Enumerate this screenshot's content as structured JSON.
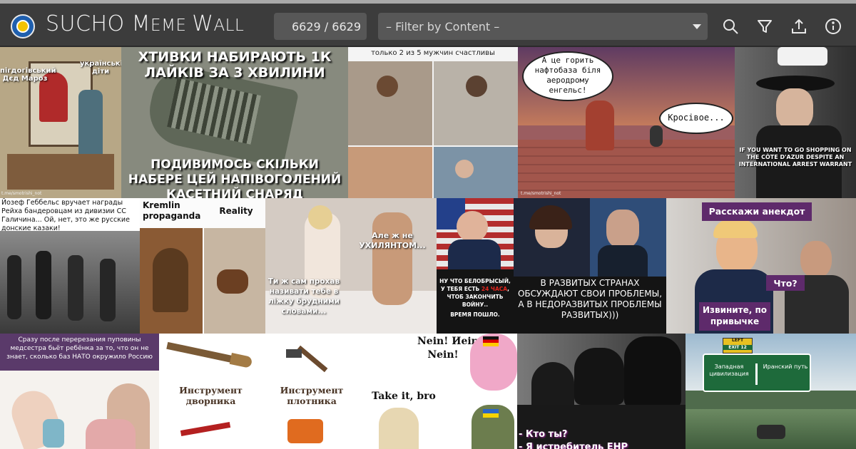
{
  "header": {
    "title_main": "SUCHO ",
    "title_sc1": "M",
    "title_sc1b": "EME ",
    "title_sc2": "W",
    "title_sc2b": "ALL",
    "counter": "6629 / 6629",
    "filter_placeholder": "– Filter by Content –"
  },
  "tools": [
    "search-icon",
    "filter-icon",
    "upload-icon",
    "info-icon"
  ],
  "memes": {
    "m1": {
      "top_left": "пігдогівський Дєд Мароз",
      "top_right": "українські діти",
      "credit": "t.me/smotrishi_not"
    },
    "m2": {
      "top": "ХТИВКИ НАБИРАЮТЬ 1К ЛАЙКІВ ЗА 3 ХВИЛИНИ",
      "bottom": "ПОДИВИМОСЬ СКІЛЬКИ НАБЕРЕ ЦЕЙ НАПІВОГОЛЕНИЙ КАСЕТНИЙ СНАРЯД"
    },
    "m3": {
      "top": "только 2 из 5 мужчин счастливы"
    },
    "m4": {
      "bubble1": "А це горить нафтобаза біля аеродрому енгельс!",
      "bubble2": "Кросівое...",
      "credit": "t.me/smotrishi_not"
    },
    "m5": {
      "caption": "IF YOU WANT TO GO SHOPPING ON THE CÔTE D'AZUR DESPITE AN INTERNATIONAL ARREST WARRANT"
    },
    "m6": {
      "top": "Йозеф Геббельс вручает награды Рейха бандеровцам из дивизии СС Галичина... Ой, нет, это же русские донские казаки!"
    },
    "m7": {
      "left": "Kremlin propaganda",
      "right": "Reality"
    },
    "m8": {
      "right": "Але ж не УХИЛЯНТОМ...",
      "left": "Ти ж сам прохав називати тебе в ліжку брудними словами..."
    },
    "m9": {
      "caption_a": "НУ ЧТО БЕЛОБРЫСЫЙ, У ТЕБЯ ЕСТЬ ",
      "caption_red": "24 ЧАСА",
      "caption_b": ", ЧТОБ ЗАКОНЧИТЬ ВОЙНУ..",
      "caption_c": "ВРЕМЯ ПОШЛО."
    },
    "m10": {
      "caption": "В РАЗВИТЫХ СТРАНАХ ОБСУЖДАЮТ СВОИ ПРОБЛЕМЫ, А В НЕДОРАЗВИТЫХ ПРОБЛЕМЫ РАЗВИТЫХ)))"
    },
    "m11": {
      "top": "Расскажи анекдот",
      "mid": "Что?",
      "bottom": "Извините, по привычке"
    },
    "m12": {
      "top": "Сразу после перерезания пуповины медсестра бьёт ребёнка за то, что он не знает, сколько баз НАТО окружило Россию"
    },
    "m13": {
      "a": "Инструмент дворника",
      "b": "Инструмент плотника"
    },
    "m14": {
      "a": "Nein! Иein!",
      "b": "Nein!",
      "c": "Take it, bro"
    },
    "m15": {
      "a": "- Кто ты?",
      "b": "- Я истребитель ЕНР"
    },
    "m16": {
      "left": "Западная цивилизация",
      "right": "Иранский путь",
      "sign_top": "LEFT",
      "sign_exit": "EXIT 12"
    }
  }
}
